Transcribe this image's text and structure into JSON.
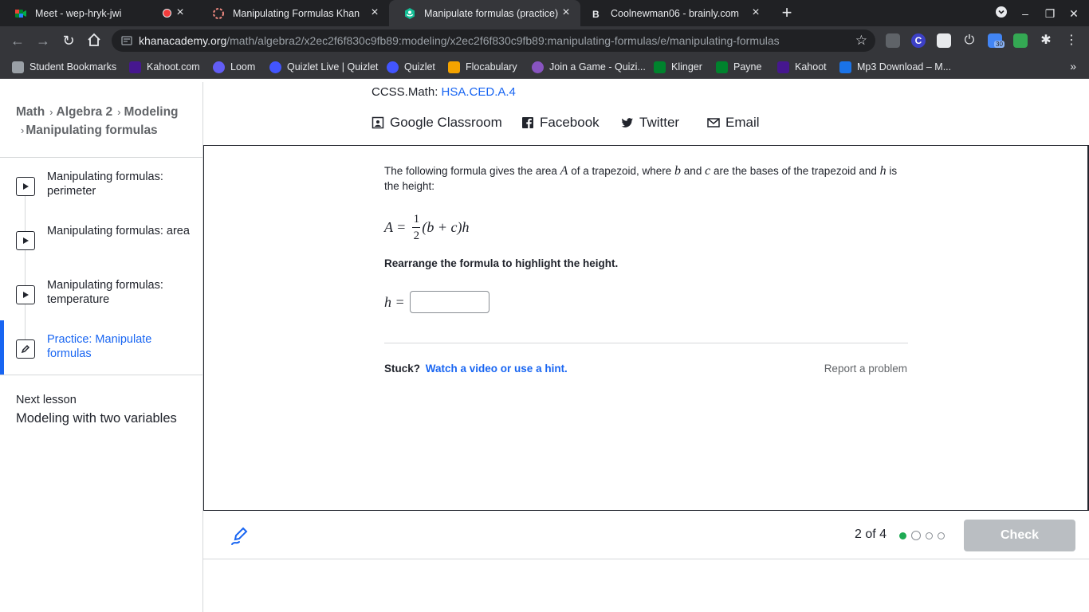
{
  "browser": {
    "tabs": [
      {
        "title": "Meet - wep-hryk-jwi"
      },
      {
        "title": "Manipulating Formulas Khan"
      },
      {
        "title": "Manipulate formulas (practice) |"
      },
      {
        "title": "Coolnewman06 - brainly.com"
      }
    ],
    "url_domain": "khanacademy.org",
    "url_path": "/math/algebra2/x2ec2f6f830c9fb89:modeling/x2ec2f6f830c9fb89:manipulating-formulas/e/manipulating-formulas",
    "bookmarks": [
      "Student Bookmarks",
      "Kahoot.com",
      "Loom",
      "Quizlet Live | Quizlet",
      "Quizlet",
      "Flocabulary",
      "Join a Game - Quizi...",
      "Klinger",
      "Payne",
      "Kahoot",
      "Mp3 Download – M..."
    ],
    "extension_badge": "30",
    "colors": {
      "tabbar": "#202124",
      "toolbar": "#35363a"
    }
  },
  "sidebar": {
    "breadcrumb": [
      "Math",
      "Algebra 2",
      "Modeling",
      "Manipulating formulas"
    ],
    "lessons": [
      {
        "label": "Manipulating formulas: perimeter",
        "icon": "play-icon"
      },
      {
        "label": "Manipulating formulas: area",
        "icon": "play-icon"
      },
      {
        "label": "Manipulating formulas: temperature",
        "icon": "play-icon"
      },
      {
        "label": "Practice: Manipulate formulas",
        "icon": "pencil-icon"
      }
    ],
    "next_lesson_label": "Next lesson",
    "next_lesson_title": "Modeling with two variables"
  },
  "header": {
    "standard_prefix": "CCSS.Math:",
    "standard_code": "HSA.CED.A.4",
    "share": [
      "Google Classroom",
      "Facebook",
      "Twitter",
      "Email"
    ]
  },
  "exercise": {
    "intro_1": "The following formula gives the area",
    "var_A": "A",
    "intro_2": "of a trapezoid, where",
    "var_b": "b",
    "intro_3": "and",
    "var_c": "c",
    "intro_4": "are the bases of the trapezoid and",
    "var_h": "h",
    "intro_5": "is the height:",
    "formula_lhs": "A =",
    "formula_num": "1",
    "formula_den": "2",
    "formula_rhs": "(b + c)h",
    "prompt": "Rearrange the formula to highlight the height.",
    "answer_label": "h =",
    "answer_value": "",
    "stuck_label": "Stuck?",
    "hint_link": "Watch a video or use a hint.",
    "report_link": "Report a problem"
  },
  "footer": {
    "progress_text": "2 of 4",
    "check_label": "Check",
    "accent": "#1865f2",
    "done_color": "#1fab54"
  }
}
